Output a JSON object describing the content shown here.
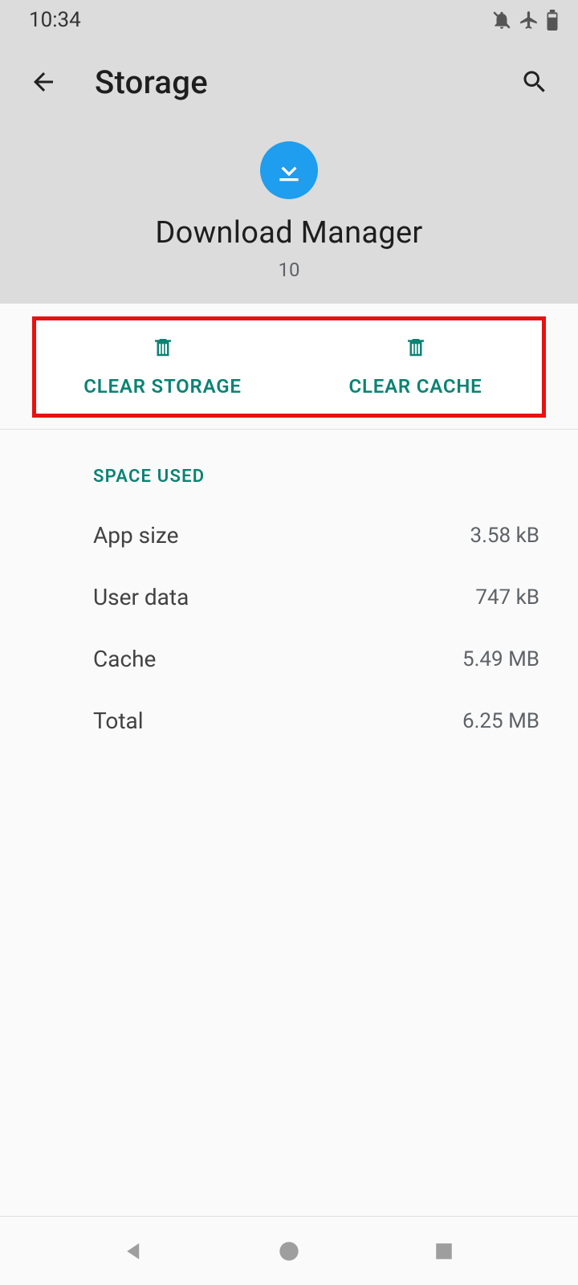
{
  "status": {
    "time": "10:34"
  },
  "toolbar": {
    "title": "Storage"
  },
  "app": {
    "name": "Download Manager",
    "version": "10"
  },
  "actions": {
    "clear_storage": "CLEAR STORAGE",
    "clear_cache": "CLEAR CACHE"
  },
  "section": {
    "title": "SPACE USED",
    "rows": [
      {
        "label": "App size",
        "value": "3.58 kB"
      },
      {
        "label": "User data",
        "value": "747 kB"
      },
      {
        "label": "Cache",
        "value": "5.49 MB"
      },
      {
        "label": "Total",
        "value": "6.25 MB"
      }
    ]
  },
  "colors": {
    "accent": "#0b8374",
    "icon_bg": "#1f9dee",
    "highlight": "#e91010"
  }
}
